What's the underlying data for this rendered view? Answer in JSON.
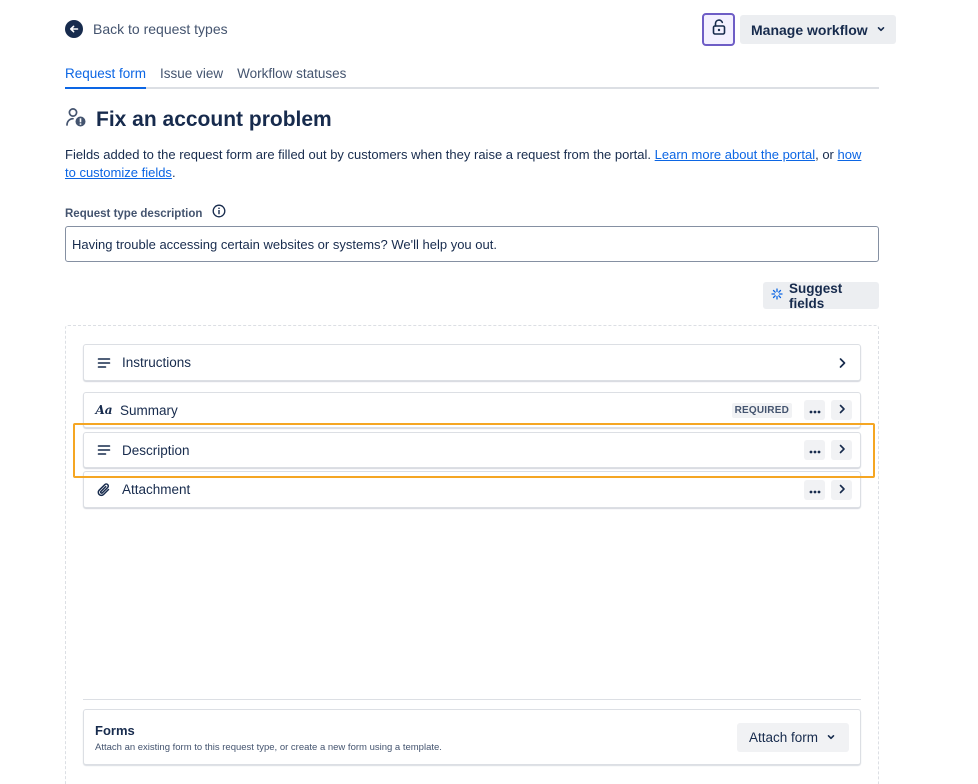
{
  "header": {
    "back_label": "Back to request types",
    "lock_icon": "unlock-icon",
    "manage_workflow_label": "Manage workflow"
  },
  "tabs": [
    {
      "label": "Request form",
      "active": true
    },
    {
      "label": "Issue view",
      "active": false
    },
    {
      "label": "Workflow statuses",
      "active": false
    }
  ],
  "page": {
    "title": "Fix an account problem",
    "intro_text": "Fields added to the request form are filled out by customers when they raise a request from the portal.",
    "intro_link1": "Learn more about the portal",
    "intro_mid": ", or",
    "intro_link2": "how to customize fields",
    "intro_end": "."
  },
  "description": {
    "label": "Request type description",
    "value": "Having trouble accessing certain websites or systems? We'll help you out."
  },
  "suggest_fields_label": "Suggest fields",
  "fields": [
    {
      "label": "Instructions",
      "icon": "text-lines-icon"
    },
    {
      "label": "Summary",
      "icon": "text-aa-icon",
      "badge": "REQUIRED"
    },
    {
      "label": "Description",
      "icon": "text-lines-icon"
    },
    {
      "label": "Attachment",
      "icon": "paperclip-icon"
    }
  ],
  "forms": {
    "title": "Forms",
    "subtitle": "Attach an existing form to this request type, or create a new form using a template.",
    "attach_label": "Attach form"
  },
  "colors": {
    "accent": "#0c66e4",
    "highlight": "#f5a623",
    "lock_border": "#6e5dc6"
  }
}
